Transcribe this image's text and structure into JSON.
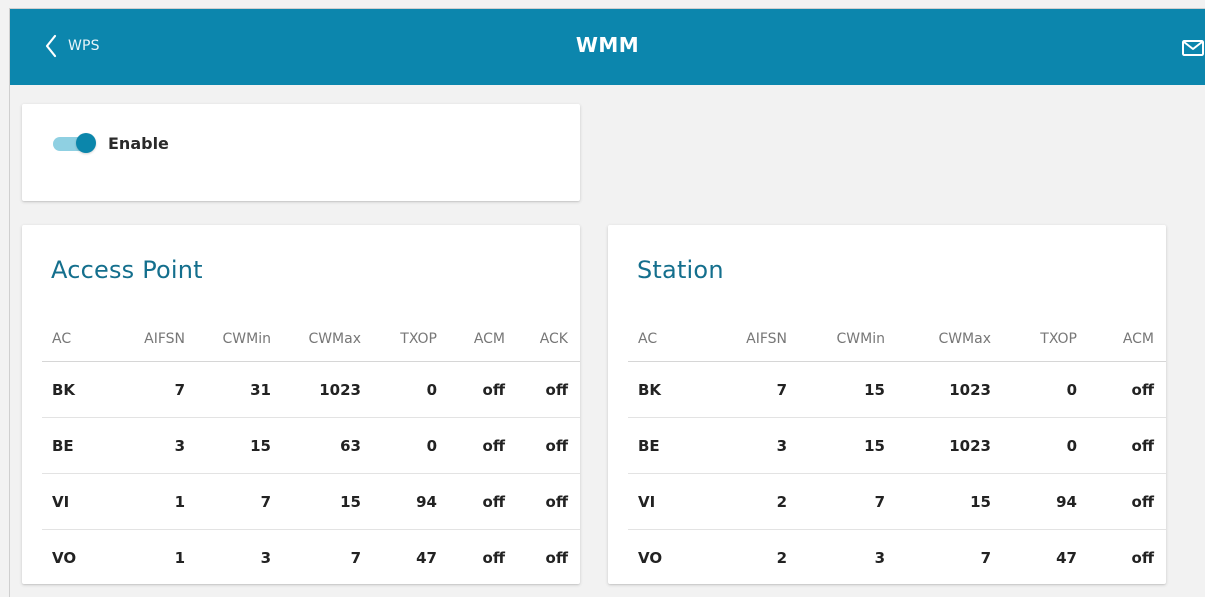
{
  "header": {
    "back_label": "WPS",
    "title": "WMM"
  },
  "enable": {
    "label": "Enable",
    "checked": true
  },
  "access_point": {
    "title": "Access Point",
    "columns": [
      "AC",
      "AIFSN",
      "CWMin",
      "CWMax",
      "TXOP",
      "ACM",
      "ACK"
    ],
    "rows": [
      [
        "BK",
        "7",
        "31",
        "1023",
        "0",
        "off",
        "off"
      ],
      [
        "BE",
        "3",
        "15",
        "63",
        "0",
        "off",
        "off"
      ],
      [
        "VI",
        "1",
        "7",
        "15",
        "94",
        "off",
        "off"
      ],
      [
        "VO",
        "1",
        "3",
        "7",
        "47",
        "off",
        "off"
      ]
    ]
  },
  "station": {
    "title": "Station",
    "columns": [
      "AC",
      "AIFSN",
      "CWMin",
      "CWMax",
      "TXOP",
      "ACM"
    ],
    "rows": [
      [
        "BK",
        "7",
        "15",
        "1023",
        "0",
        "off"
      ],
      [
        "BE",
        "3",
        "15",
        "1023",
        "0",
        "off"
      ],
      [
        "VI",
        "2",
        "7",
        "15",
        "94",
        "off"
      ],
      [
        "VO",
        "2",
        "3",
        "7",
        "47",
        "off"
      ]
    ]
  },
  "colors": {
    "header": "#0c86ad",
    "accent": "#146f8d",
    "toggle_on": "#0b86ab",
    "toggle_track": "#8fd0e2",
    "background": "#f2f2f2"
  },
  "icons": {
    "back": "chevron-left-icon",
    "mail": "mail-icon"
  }
}
